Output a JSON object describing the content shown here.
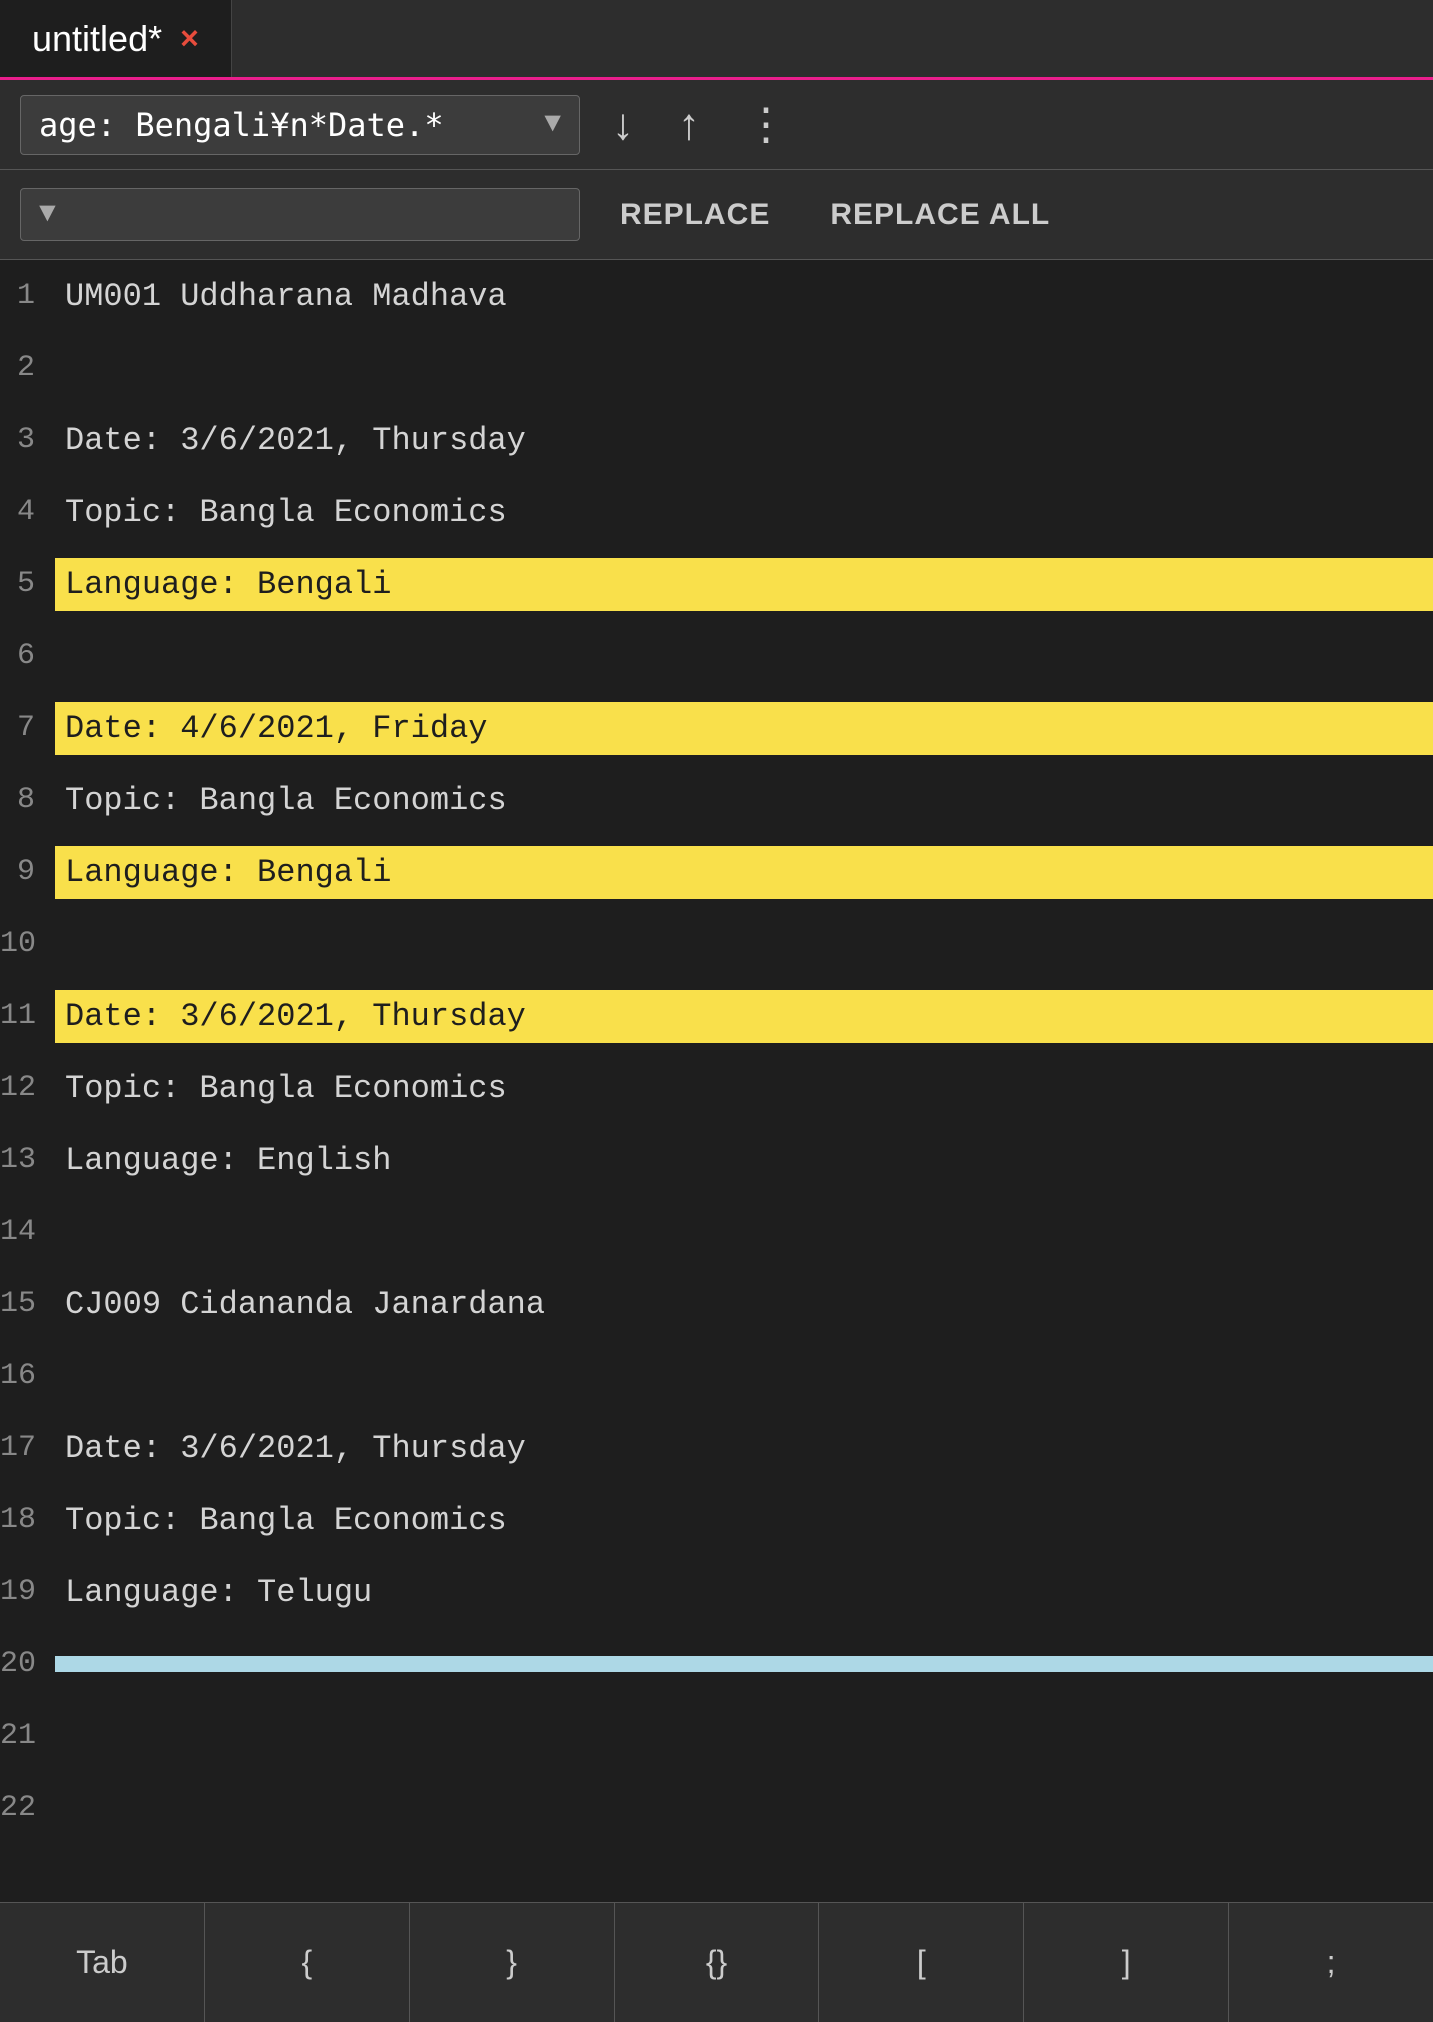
{
  "tab": {
    "title": "untitled*",
    "close_label": "×"
  },
  "search": {
    "query": "age: Bengali¥n*Date.*",
    "dropdown_arrow": "▼",
    "nav_down": "↓",
    "nav_up": "↑",
    "more": "⋮"
  },
  "replace": {
    "dropdown_arrow": "▼",
    "replace_label": "REPLACE",
    "replace_all_label": "REPLACE ALL"
  },
  "lines": [
    {
      "number": "1",
      "text": "UM001  Uddharana Madhava",
      "highlight": null
    },
    {
      "number": "2",
      "text": "",
      "highlight": null
    },
    {
      "number": "3",
      "text": "Date: 3/6/2021, Thursday",
      "highlight": null
    },
    {
      "number": "4",
      "text": "Topic: Bangla Economics",
      "highlight": null
    },
    {
      "number": "5",
      "text": "Language: Bengali",
      "highlight": "yellow"
    },
    {
      "number": "6",
      "text": "",
      "highlight": null
    },
    {
      "number": "7",
      "text": "Date: 4/6/2021, Friday",
      "highlight": "yellow"
    },
    {
      "number": "8",
      "text": "Topic: Bangla Economics",
      "highlight": null
    },
    {
      "number": "9",
      "text": "Language: Bengali",
      "highlight": "yellow"
    },
    {
      "number": "10",
      "text": "",
      "highlight": null
    },
    {
      "number": "11",
      "text": "Date: 3/6/2021, Thursday",
      "highlight": "yellow"
    },
    {
      "number": "12",
      "text": "Topic: Bangla Economics",
      "highlight": null
    },
    {
      "number": "13",
      "text": "Language: English",
      "highlight": null
    },
    {
      "number": "14",
      "text": "",
      "highlight": null
    },
    {
      "number": "15",
      "text": "CJ009  Cidananda Janardana",
      "highlight": null
    },
    {
      "number": "16",
      "text": "",
      "highlight": null
    },
    {
      "number": "17",
      "text": "Date: 3/6/2021, Thursday",
      "highlight": null
    },
    {
      "number": "18",
      "text": "Topic: Bangla Economics",
      "highlight": null
    },
    {
      "number": "19",
      "text": "Language: Telugu",
      "highlight": null
    },
    {
      "number": "20",
      "text": "",
      "highlight": "blue"
    },
    {
      "number": "21",
      "text": "",
      "highlight": null
    },
    {
      "number": "22",
      "text": "",
      "highlight": null
    }
  ],
  "keyboard": {
    "keys": [
      "Tab",
      "{",
      "}",
      "{}",
      "[",
      "]",
      ";"
    ]
  }
}
